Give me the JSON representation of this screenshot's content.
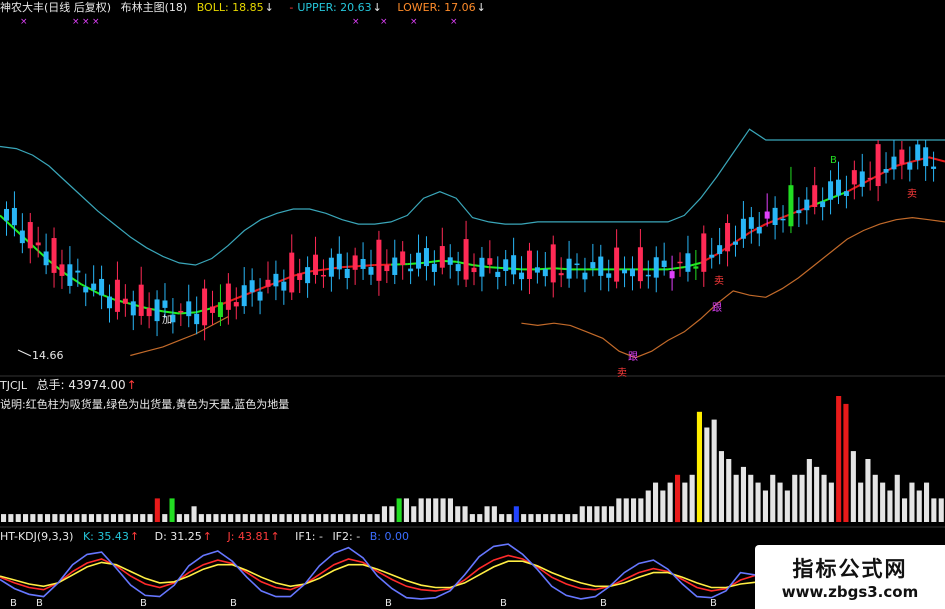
{
  "header": {
    "stock": "神农大丰(日线 后复权)",
    "indicator": "布林主图(18)",
    "boll_label": "BOLL:",
    "boll_value": "18.85",
    "upper_label": "UPPER:",
    "upper_value": "20.63",
    "lower_label": "LOWER:",
    "lower_value": "17.06",
    "down_arrow": "↓"
  },
  "price_panel": {
    "low_marker": "14.66",
    "signals": [
      "加",
      "卖",
      "跟",
      "跟",
      "卖",
      "卖",
      "B"
    ]
  },
  "volume_panel": {
    "name": "TJCJL",
    "total_label": "总手:",
    "total_value": "43974.00",
    "up_arrow": "↑",
    "description": "说明:红色柱为吸货量,绿色为出货量,黄色为天量,蓝色为地量"
  },
  "kdj_panel": {
    "name": "HT-KDJ(9,3,3)",
    "k_label": "K:",
    "k_value": "35.43",
    "d_label": "D:",
    "d_value": "31.25",
    "j_label": "J:",
    "j_value": "43.81",
    "if1_label": "IF1:",
    "if1_value": "-",
    "if2_label": "IF2:",
    "if2_value": "-",
    "b_label": "B:",
    "b_value": "0.00",
    "bottom_marker": "B"
  },
  "watermark": {
    "title": "指标公式网",
    "url": "www.zbgs3.com"
  },
  "colors": {
    "background": "#000000",
    "up_candle": "#ff2a55",
    "down_candle": "#29b6f6",
    "buy_candle": "#22dd22",
    "special_candle": "#e040fb",
    "middle_line_red": "#e81a1a",
    "middle_line_green": "#22ee22",
    "upper_band": "#3aa6b9",
    "lower_band": "#c26a2a",
    "volume_white": "#e4e4e4",
    "volume_red": "#e81a1a",
    "volume_green": "#22dd22",
    "volume_yellow": "#ffee00",
    "volume_blue": "#2244ff",
    "k_line": "#ff2a2a",
    "d_line": "#ffee44",
    "j_line": "#6677ff"
  },
  "chart_data": [
    {
      "type": "line",
      "panel": "price",
      "title": "布林主图(18)",
      "y_estimate_range": [
        14.2,
        24.5
      ],
      "series": [
        {
          "name": "BOLL",
          "values": [
            21.0,
            20.3,
            19.6,
            18.9,
            18.3,
            17.8,
            17.4,
            17.1,
            16.9,
            16.7,
            16.55,
            16.45,
            16.5,
            16.7,
            17.0,
            17.3,
            17.6,
            17.9,
            18.2,
            18.4,
            18.5,
            18.6,
            18.65,
            18.7,
            18.72,
            18.74,
            18.8,
            18.9,
            18.85,
            18.7,
            18.6,
            18.55,
            18.5,
            18.5,
            18.55,
            18.5,
            18.5,
            18.5,
            18.5,
            18.5,
            18.5,
            18.5,
            18.6,
            18.8,
            19.2,
            19.7,
            20.2,
            20.6,
            20.9,
            21.2,
            21.5,
            21.8,
            22.1,
            22.5,
            22.9,
            23.3,
            23.5,
            23.7,
            23.5
          ]
        },
        {
          "name": "UPPER",
          "values": [
            24.2,
            24.1,
            23.8,
            23.3,
            22.6,
            21.9,
            21.2,
            20.6,
            20.0,
            19.5,
            19.1,
            18.8,
            18.7,
            19.0,
            19.6,
            20.3,
            20.8,
            21.1,
            21.3,
            21.3,
            21.1,
            20.8,
            20.6,
            20.6,
            20.7,
            21.0,
            21.8,
            22.1,
            21.8,
            20.9,
            20.7,
            20.6,
            20.6,
            20.7,
            20.7,
            20.7,
            20.7,
            20.7,
            20.7,
            20.7,
            20.7,
            20.7,
            21.0,
            21.8,
            22.8,
            23.9,
            25.0,
            24.5,
            24.5,
            24.5,
            24.5,
            24.5,
            24.5,
            24.5,
            24.5,
            24.5,
            24.5,
            24.5,
            24.5
          ]
        },
        {
          "name": "LOWER",
          "values": [
            null,
            null,
            null,
            null,
            null,
            null,
            null,
            null,
            14.5,
            14.7,
            14.9,
            15.2,
            15.5,
            15.9,
            16.3,
            null,
            null,
            null,
            null,
            null,
            null,
            null,
            null,
            null,
            null,
            null,
            null,
            null,
            null,
            null,
            null,
            null,
            16.0,
            15.9,
            16.0,
            15.9,
            15.6,
            15.3,
            14.7,
            14.4,
            14.7,
            15.2,
            15.6,
            16.2,
            16.9,
            17.5,
            17.3,
            17.2,
            17.6,
            18.1,
            18.7,
            19.3,
            19.9,
            20.3,
            20.6,
            20.8,
            20.9,
            20.8,
            20.7
          ]
        }
      ],
      "annotations": [
        "14.66"
      ]
    },
    {
      "type": "bar",
      "panel": "volume",
      "title": "TJCJL",
      "color_legend": "说明:红色柱为吸货量,绿色为出货量,黄色为天量,蓝色为地量",
      "values": [
        1,
        1,
        1,
        1,
        1,
        1,
        1,
        1,
        1,
        1,
        1,
        1,
        1,
        1,
        1,
        1,
        1,
        1,
        1,
        1,
        1,
        3,
        1,
        3,
        1,
        1,
        2,
        1,
        1,
        1,
        1,
        1,
        1,
        1,
        1,
        1,
        1,
        1,
        1,
        1,
        1,
        1,
        1,
        1,
        1,
        1,
        1,
        1,
        1,
        1,
        1,
        1,
        2,
        2,
        3,
        3,
        2,
        3,
        3,
        3,
        3,
        3,
        2,
        2,
        1,
        1,
        2,
        2,
        1,
        1,
        2,
        1,
        1,
        1,
        1,
        1,
        1,
        1,
        1,
        2,
        2,
        2,
        2,
        2,
        3,
        3,
        3,
        3,
        4,
        5,
        4,
        5,
        6,
        5,
        6,
        14,
        12,
        13,
        9,
        8,
        6,
        7,
        6,
        5,
        4,
        6,
        5,
        4,
        6,
        6,
        8,
        7,
        6,
        5,
        16,
        15,
        9,
        5,
        8,
        6,
        5,
        4,
        6,
        3,
        5,
        4,
        5,
        3,
        3
      ],
      "notes": "relative heights only; values not labeled in the chart"
    },
    {
      "type": "line",
      "panel": "kdj",
      "title": "HT-KDJ(9,3,3)",
      "series": [
        {
          "name": "K",
          "values": [
            40,
            30,
            22,
            18,
            30,
            50,
            65,
            72,
            60,
            42,
            28,
            22,
            30,
            48,
            62,
            70,
            64,
            48,
            32,
            22,
            18,
            28,
            45,
            62,
            72,
            66,
            50,
            36,
            24,
            18,
            16,
            20,
            35,
            55,
            70,
            78,
            72,
            58,
            40,
            28,
            20,
            18,
            24,
            36,
            48,
            55,
            50,
            36,
            22,
            16,
            20,
            35,
            43
          ]
        },
        {
          "name": "D",
          "values": [
            42,
            35,
            28,
            24,
            30,
            44,
            58,
            66,
            62,
            50,
            38,
            30,
            32,
            42,
            54,
            62,
            62,
            52,
            40,
            30,
            24,
            28,
            38,
            52,
            62,
            62,
            54,
            44,
            34,
            26,
            22,
            22,
            30,
            44,
            58,
            68,
            68,
            60,
            48,
            38,
            30,
            24,
            24,
            30,
            40,
            48,
            48,
            40,
            30,
            22,
            22,
            28,
            31
          ]
        },
        {
          "name": "J",
          "values": [
            36,
            20,
            10,
            6,
            30,
            62,
            80,
            84,
            56,
            26,
            8,
            6,
            26,
            60,
            78,
            86,
            68,
            40,
            16,
            6,
            6,
            28,
            60,
            82,
            92,
            74,
            42,
            20,
            4,
            2,
            4,
            16,
            44,
            76,
            94,
            98,
            80,
            54,
            24,
            8,
            2,
            6,
            24,
            48,
            64,
            70,
            54,
            28,
            6,
            4,
            16,
            48,
            44
          ]
        }
      ],
      "annotations": [
        "B",
        "B",
        "B",
        "B",
        "B",
        "B",
        "B",
        "B"
      ]
    }
  ]
}
